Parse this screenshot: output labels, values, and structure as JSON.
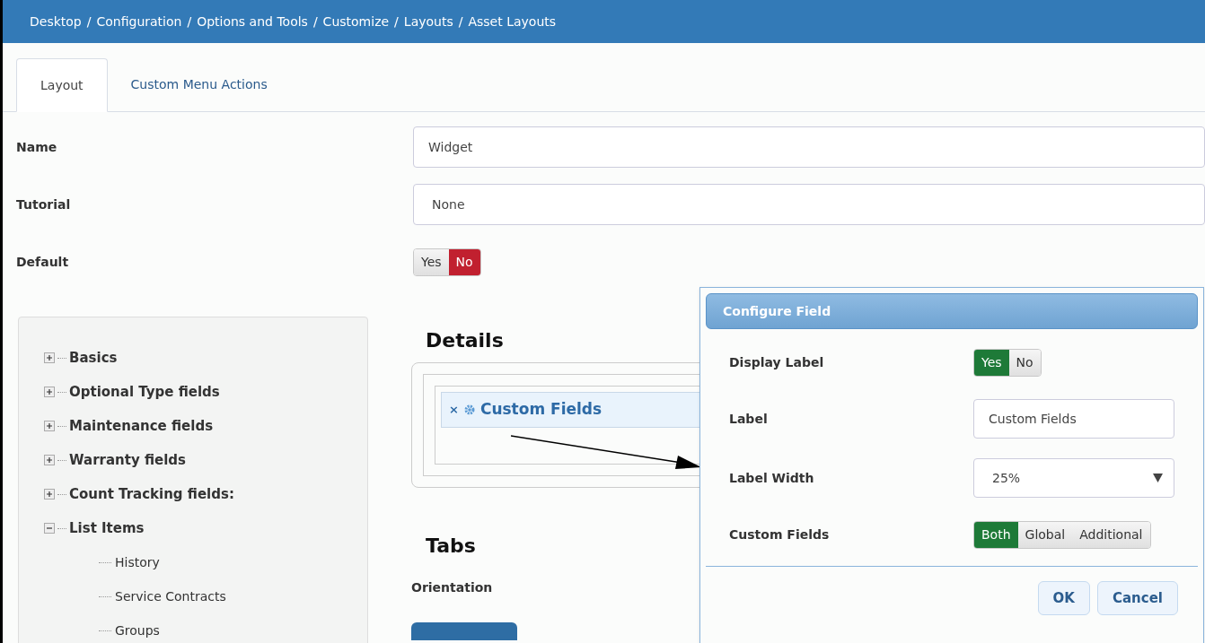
{
  "breadcrumb_separator": "/",
  "breadcrumb": [
    "Desktop",
    "Configuration",
    "Options and Tools",
    "Customize",
    "Layouts",
    "Asset Layouts"
  ],
  "tabs": [
    {
      "label": "Layout",
      "selected": true
    },
    {
      "label": "Custom Menu Actions",
      "selected": false
    }
  ],
  "form": [
    {
      "kind": "text",
      "label": "Name",
      "value": "Widget"
    },
    {
      "kind": "select",
      "label": "Tutorial",
      "value": "None"
    },
    {
      "kind": "toggle",
      "label": "Default",
      "color": "#c1202f",
      "options": [
        {
          "label": "Yes",
          "selected": false
        },
        {
          "label": "No",
          "selected": true
        }
      ]
    }
  ],
  "tree": [
    {
      "label": "Basics",
      "expanded": false
    },
    {
      "label": "Optional Type fields",
      "expanded": false
    },
    {
      "label": "Maintenance fields",
      "expanded": false
    },
    {
      "label": "Warranty fields",
      "expanded": false
    },
    {
      "label": "Count Tracking fields:",
      "expanded": false
    },
    {
      "label": "List Items",
      "expanded": true,
      "children": [
        {
          "label": "History"
        },
        {
          "label": "Service Contracts"
        },
        {
          "label": "Groups"
        }
      ]
    }
  ],
  "details": {
    "heading": "Details",
    "remove_symbol": "×",
    "field": "Custom Fields"
  },
  "tabs_section": {
    "heading": "Tabs",
    "orientation_label": "Orientation"
  },
  "dialog": {
    "title": "Configure Field",
    "rows": [
      {
        "kind": "toggle",
        "label": "Display Label",
        "color": "#1e7a38",
        "options": [
          {
            "label": "Yes",
            "selected": true
          },
          {
            "label": "No",
            "selected": false
          }
        ]
      },
      {
        "kind": "text",
        "label": "Label",
        "value": "Custom Fields"
      },
      {
        "kind": "select",
        "label": "Label Width",
        "value": "25%"
      },
      {
        "kind": "toggle",
        "label": "Custom Fields",
        "color": "#1e7a38",
        "options": [
          {
            "label": "Both",
            "selected": true
          },
          {
            "label": "Global",
            "selected": false
          },
          {
            "label": "Additional",
            "selected": false
          }
        ]
      }
    ],
    "buttons": [
      "OK",
      "Cancel"
    ]
  }
}
